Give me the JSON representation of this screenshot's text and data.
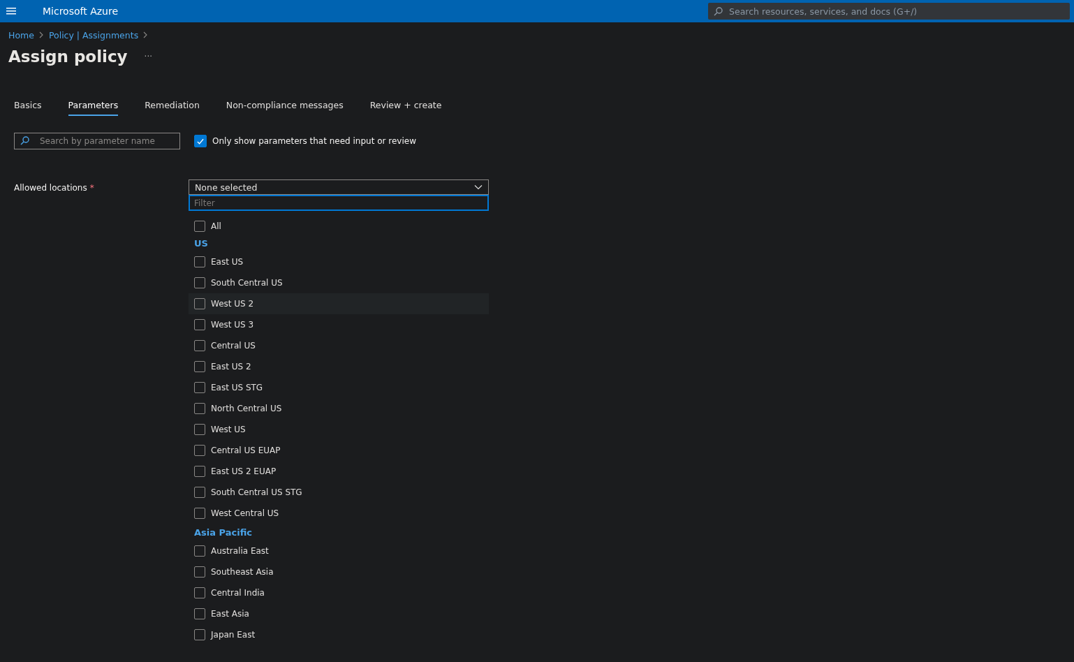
{
  "header": {
    "title": "Microsoft Azure",
    "search": {
      "placeholder": "Search resources, services, and docs (G+/)"
    }
  },
  "breadcrumb": [
    "Home",
    "Policy | Assignments"
  ],
  "page_title": "Assign policy",
  "more": "···",
  "tabs": [
    {
      "label": "Basics",
      "selected": false
    },
    {
      "label": "Parameters",
      "selected": true
    },
    {
      "label": "Remediation",
      "selected": false
    },
    {
      "label": "Non-compliance messages",
      "selected": false
    },
    {
      "label": "Review + create",
      "selected": false
    }
  ],
  "parameter_search": {
    "placeholder": "Search by parameter name"
  },
  "only_show_filter": {
    "label": "Only show parameters that need input or review",
    "checked": true
  },
  "parameter": {
    "label": "Allowed locations",
    "required": true,
    "required_mark": "*",
    "dropdown": {
      "value": "None selected",
      "expanded": true,
      "filter": {
        "placeholder": "Filter"
      },
      "items": [
        {
          "kind": "option",
          "label": "All",
          "checked": false,
          "highlighted": false
        },
        {
          "kind": "group",
          "label": "US"
        },
        {
          "kind": "option",
          "label": "East US",
          "checked": false,
          "highlighted": false
        },
        {
          "kind": "option",
          "label": "South Central US",
          "checked": false,
          "highlighted": false
        },
        {
          "kind": "option",
          "label": "West US 2",
          "checked": false,
          "highlighted": true
        },
        {
          "kind": "option",
          "label": "West US 3",
          "checked": false,
          "highlighted": false
        },
        {
          "kind": "option",
          "label": "Central US",
          "checked": false,
          "highlighted": false
        },
        {
          "kind": "option",
          "label": "East US 2",
          "checked": false,
          "highlighted": false
        },
        {
          "kind": "option",
          "label": "East US STG",
          "checked": false,
          "highlighted": false
        },
        {
          "kind": "option",
          "label": "North Central US",
          "checked": false,
          "highlighted": false
        },
        {
          "kind": "option",
          "label": "West US",
          "checked": false,
          "highlighted": false
        },
        {
          "kind": "option",
          "label": "Central US EUAP",
          "checked": false,
          "highlighted": false
        },
        {
          "kind": "option",
          "label": "East US 2 EUAP",
          "checked": false,
          "highlighted": false
        },
        {
          "kind": "option",
          "label": "South Central US STG",
          "checked": false,
          "highlighted": false
        },
        {
          "kind": "option",
          "label": "West Central US",
          "checked": false,
          "highlighted": false
        },
        {
          "kind": "group",
          "label": "Asia Pacific"
        },
        {
          "kind": "option",
          "label": "Australia East",
          "checked": false,
          "highlighted": false
        },
        {
          "kind": "option",
          "label": "Southeast Asia",
          "checked": false,
          "highlighted": false
        },
        {
          "kind": "option",
          "label": "Central India",
          "checked": false,
          "highlighted": false
        },
        {
          "kind": "option",
          "label": "East Asia",
          "checked": false,
          "highlighted": false
        },
        {
          "kind": "option",
          "label": "Japan East",
          "checked": false,
          "highlighted": false
        }
      ]
    }
  }
}
